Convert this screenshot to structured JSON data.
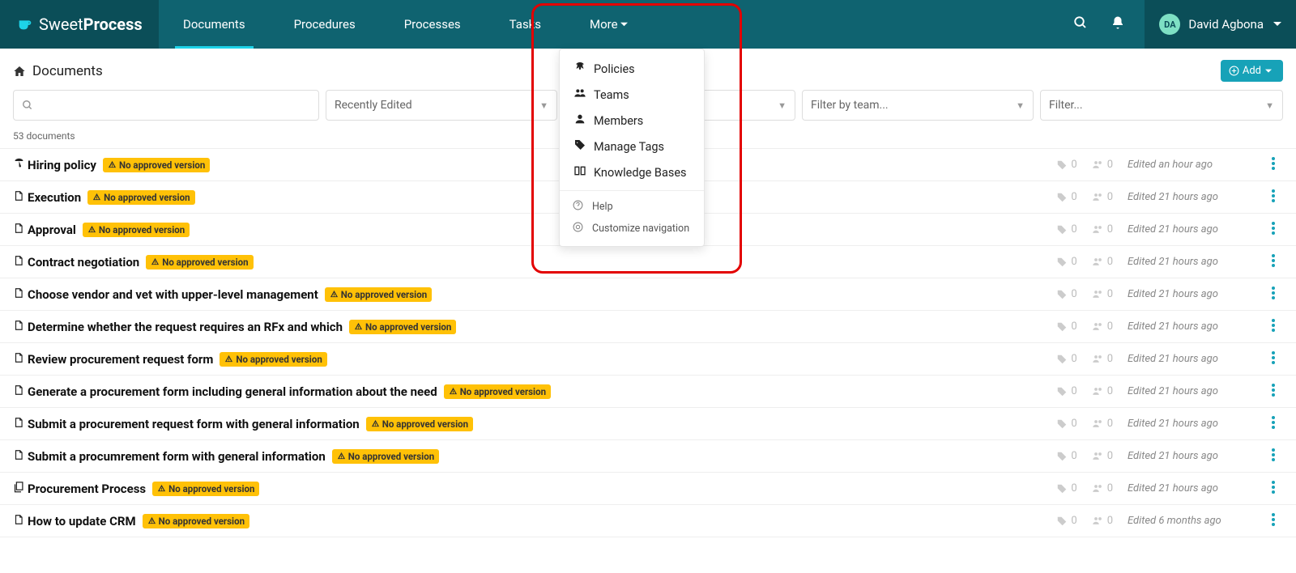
{
  "brand": {
    "part1": "Sweet",
    "part2": "Process"
  },
  "nav": {
    "items": [
      "Documents",
      "Procedures",
      "Processes",
      "Tasks",
      "More"
    ],
    "activeIndex": 0
  },
  "user": {
    "initials": "DA",
    "name": "David Agbona"
  },
  "page_title": "Documents",
  "add_button": "Add",
  "filters": {
    "sort_value": "Recently Edited",
    "team_placeholder": "Filter by team...",
    "tag_placeholder": "Filter..."
  },
  "count_text": "53 documents",
  "badge_text": "No approved version",
  "dropdown": {
    "main": [
      "Policies",
      "Teams",
      "Members",
      "Manage Tags",
      "Knowledge Bases"
    ],
    "footer": [
      "Help",
      "Customize navigation"
    ]
  },
  "documents": [
    {
      "icon": "umbrella",
      "title": "Hiring policy",
      "tags": 0,
      "members": 0,
      "edited": "Edited an hour ago"
    },
    {
      "icon": "doc",
      "title": "Execution",
      "tags": 0,
      "members": 0,
      "edited": "Edited 21 hours ago"
    },
    {
      "icon": "doc",
      "title": "Approval",
      "tags": 0,
      "members": 0,
      "edited": "Edited 21 hours ago"
    },
    {
      "icon": "doc",
      "title": "Contract negotiation",
      "tags": 0,
      "members": 0,
      "edited": "Edited 21 hours ago"
    },
    {
      "icon": "doc",
      "title": "Choose vendor and vet with upper-level management",
      "tags": 0,
      "members": 0,
      "edited": "Edited 21 hours ago"
    },
    {
      "icon": "doc",
      "title": "Determine whether the request requires an RFx and which",
      "tags": 0,
      "members": 0,
      "edited": "Edited 21 hours ago"
    },
    {
      "icon": "doc",
      "title": "Review procurement request form",
      "tags": 0,
      "members": 0,
      "edited": "Edited 21 hours ago"
    },
    {
      "icon": "doc",
      "title": "Generate a procurement form including general information about the need",
      "tags": 0,
      "members": 0,
      "edited": "Edited 21 hours ago"
    },
    {
      "icon": "doc",
      "title": "Submit a procurement request form with general information",
      "tags": 0,
      "members": 0,
      "edited": "Edited 21 hours ago"
    },
    {
      "icon": "doc",
      "title": "Submit a procumrement form with general information",
      "tags": 0,
      "members": 0,
      "edited": "Edited 21 hours ago"
    },
    {
      "icon": "multi",
      "title": "Procurement Process",
      "tags": 0,
      "members": 0,
      "edited": "Edited 21 hours ago"
    },
    {
      "icon": "doc",
      "title": "How to update CRM",
      "tags": 0,
      "members": 0,
      "edited": "Edited 6 months ago"
    }
  ]
}
